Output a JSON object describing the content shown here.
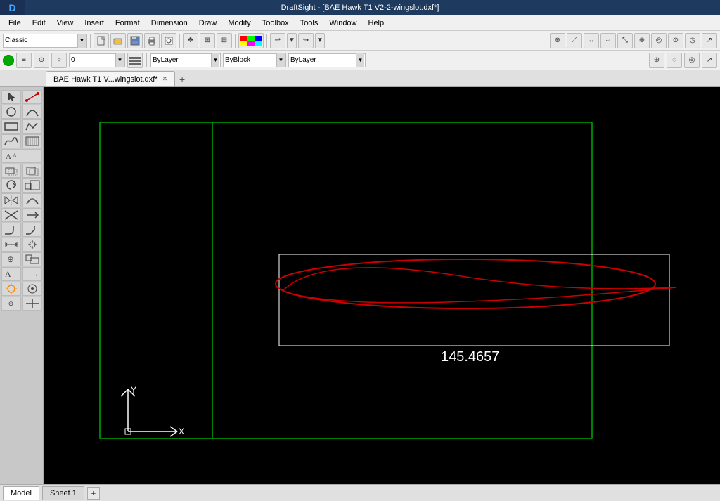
{
  "titleBar": {
    "text": "DraftSight - [BAE Hawk T1 V2-2-wingslot.dxf*]"
  },
  "menuBar": {
    "items": [
      "File",
      "Edit",
      "View",
      "Insert",
      "Format",
      "Dimension",
      "Draw",
      "Modify",
      "Toolbox",
      "Tools",
      "Window",
      "Help"
    ]
  },
  "toolbar1": {
    "combo": {
      "value": "Classic",
      "placeholder": "Classic"
    },
    "buttons": [
      "new",
      "open",
      "save",
      "print",
      "print-preview",
      "undo",
      "redo"
    ]
  },
  "toolbar2": {
    "statusIndicator": "0",
    "layerLabel": "ByLayer",
    "colorLabel": "ByBlock",
    "linetypeLabel": "ByLayer"
  },
  "tabs": {
    "items": [
      {
        "label": "BAE Hawk T1 V...wingslot.dxf*",
        "active": true
      }
    ],
    "addLabel": "+"
  },
  "drawing": {
    "measurement": "145.4657",
    "axisOriginX": 120,
    "axisOriginY": 505
  },
  "statusBar": {
    "tabs": [
      "Model",
      "Sheet 1"
    ],
    "activeTab": "Model",
    "addLabel": "+"
  },
  "palette": {
    "tools": [
      "pointer",
      "line",
      "circle",
      "arc",
      "rectangle",
      "polyline",
      "spline",
      "ellipse",
      "hatch",
      "text",
      "dimension",
      "move",
      "copy",
      "rotate",
      "scale",
      "mirror",
      "offset",
      "trim",
      "extend",
      "fillet",
      "chamfer",
      "explode",
      "block",
      "insert",
      "snap"
    ]
  }
}
